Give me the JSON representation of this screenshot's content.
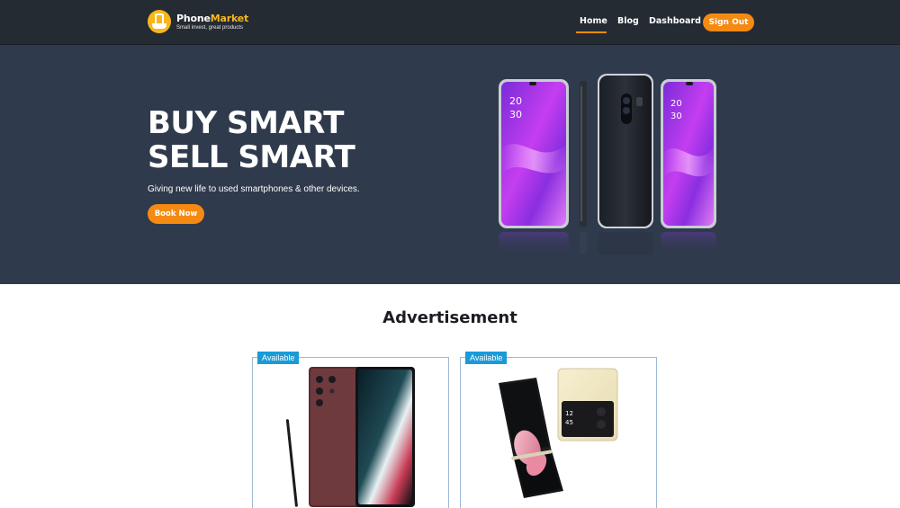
{
  "navbar": {
    "brand_part1": "Phone",
    "brand_part2": "Market",
    "tagline": "Small invest, great products",
    "links": {
      "home": "Home",
      "blog": "Blog",
      "dashboard": "Dashboard"
    },
    "signout_label": "Sign Out",
    "active_link": "Home"
  },
  "hero": {
    "title_line1": "BUY SMART",
    "title_line2": "SELL SMART",
    "subtitle": "Giving new life to used smartphones & other devices.",
    "cta_label": "Book Now",
    "phone_clock_hour": "20",
    "phone_clock_minute": "30"
  },
  "advertisement": {
    "heading": "Advertisement",
    "cards": [
      {
        "badge": "Available",
        "product_icon": "stylus-phone-image"
      },
      {
        "badge": "Available",
        "product_icon": "flip-phone-image"
      }
    ]
  },
  "colors": {
    "navbar_bg": "#252b32",
    "hero_bg": "#2f3a4c",
    "accent_orange": "#f58a12",
    "brand_yellow": "#f7b71b",
    "badge_blue": "#1a9bd7"
  }
}
